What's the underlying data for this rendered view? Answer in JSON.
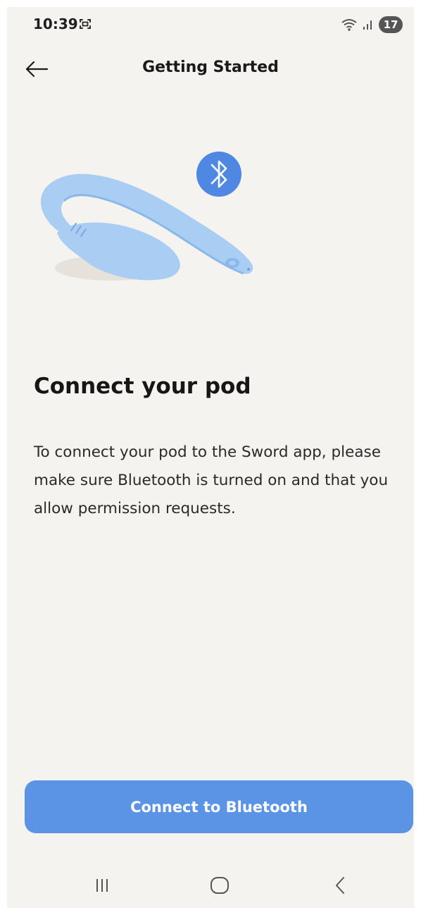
{
  "status_bar": {
    "time": "10:39",
    "battery": "17",
    "icons": [
      "screenshot-icon",
      "wifi-icon",
      "signal-icon"
    ]
  },
  "app_bar": {
    "title": "Getting Started",
    "back_icon": "arrow-left-icon"
  },
  "illustration": {
    "subject": "pod-device",
    "badge_icon": "bluetooth-icon",
    "colors": {
      "device": "#a9cdf3",
      "device_shade": "#8bb8eb",
      "badge": "#4f88e2",
      "shadow": "#e6e1da"
    }
  },
  "content": {
    "title": "Connect your pod",
    "body": "To connect your pod to the Sword app, please make sure Bluetooth is turned on and that you allow permission requests."
  },
  "primary_button": {
    "label": "Connect to Bluetooth",
    "color": "#5b93e5"
  },
  "nav_bar": {
    "items": [
      "recent-apps-icon",
      "home-icon",
      "back-icon"
    ]
  },
  "colors": {
    "background": "#f5f3ef",
    "text": "#161616",
    "accent": "#5b93e5"
  }
}
